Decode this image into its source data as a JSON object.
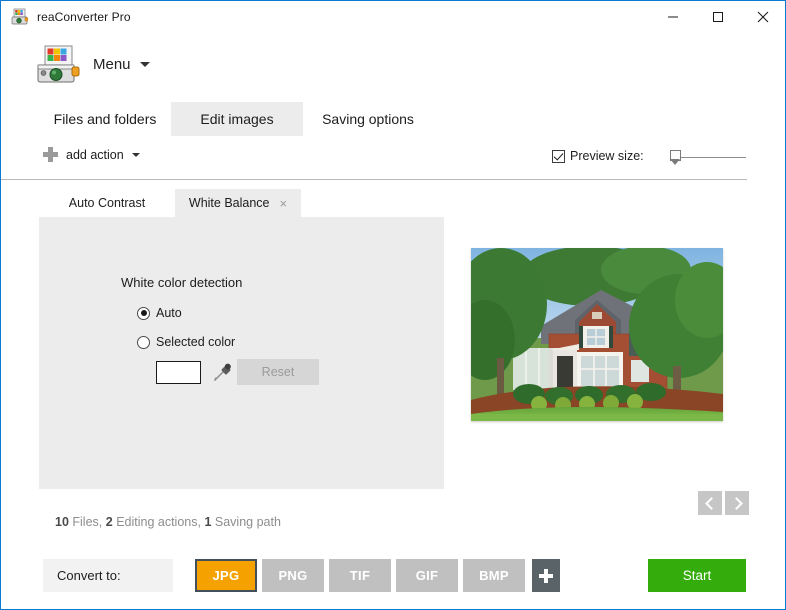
{
  "window": {
    "title": "reaConverter Pro",
    "icon": "app-scanner-icon",
    "controls": {
      "minimize": "–",
      "maximize": "☐",
      "close": "×"
    },
    "border_color": "#0a7bd4"
  },
  "menu": {
    "label": "Menu",
    "caret": "▾"
  },
  "main_tabs": [
    {
      "label": "Files and folders",
      "active": false
    },
    {
      "label": "Edit images",
      "active": true
    },
    {
      "label": "Saving options",
      "active": false
    }
  ],
  "toolbar": {
    "add_action_label": "add action",
    "add_action_icon": "plus-icon",
    "preview_size_label": "Preview size:",
    "preview_size_checked": true,
    "slider_value": 0
  },
  "sub_tabs": [
    {
      "label": "Auto Contrast",
      "active": false,
      "closable": false
    },
    {
      "label": "White Balance",
      "active": true,
      "closable": true,
      "close_glyph": "×"
    }
  ],
  "options": {
    "group_title": "White color detection",
    "radios": [
      {
        "label": "Auto",
        "selected": true
      },
      {
        "label": "Selected color",
        "selected": false
      }
    ],
    "color_swatch_value": "#ffffff",
    "eyedropper_icon": "eyedropper-icon",
    "reset_label": "Reset",
    "reset_enabled": false
  },
  "preview": {
    "image_alt": "brick house with trees and landscaped lawn",
    "prev_label": "‹",
    "next_label": "›"
  },
  "status": {
    "files_count": "10",
    "files_label": "Files,",
    "actions_count": "2",
    "actions_label": "Editing actions,",
    "paths_count": "1",
    "paths_label": "Saving path"
  },
  "bottom": {
    "convert_to_label": "Convert to:",
    "formats": [
      {
        "label": "JPG",
        "selected": true
      },
      {
        "label": "PNG",
        "selected": false
      },
      {
        "label": "TIF",
        "selected": false
      },
      {
        "label": "GIF",
        "selected": false
      },
      {
        "label": "BMP",
        "selected": false
      }
    ],
    "add_format_icon": "plus-icon",
    "start_label": "Start"
  },
  "colors": {
    "accent_orange": "#f5a100",
    "start_green": "#34ac0c",
    "panel_gray": "#ececec",
    "format_gray": "#c0c0c0",
    "dark_slate": "#5a6367"
  }
}
